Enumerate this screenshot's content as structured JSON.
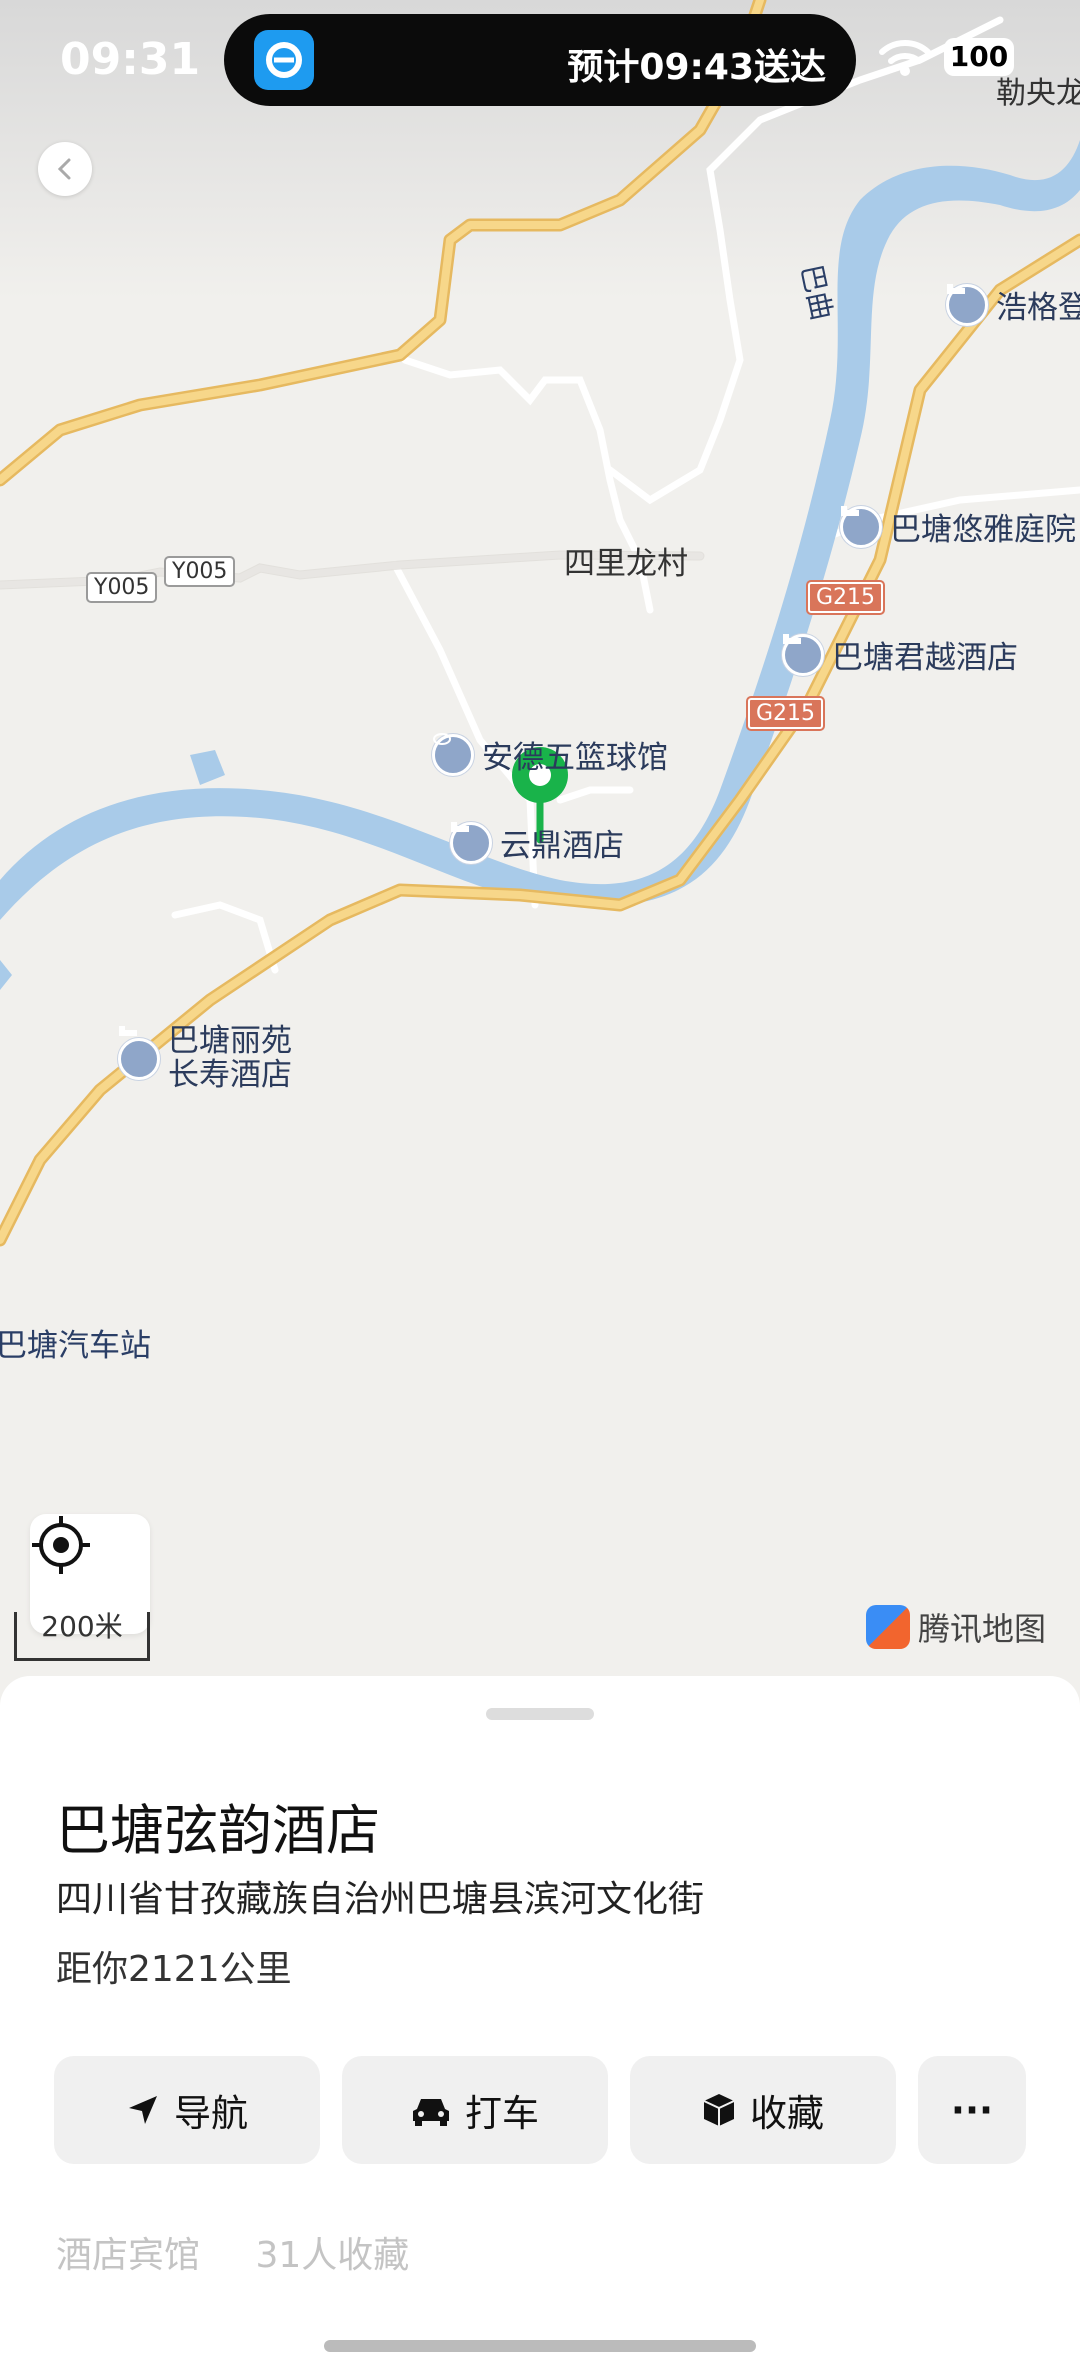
{
  "status_bar": {
    "time": "09:31",
    "eta": "预计09:43送达",
    "battery": "100"
  },
  "map": {
    "labels": {
      "village": "四里龙村",
      "river": "巴曲",
      "top_right": "勒央龙",
      "bus_station": "巴塘汽车站"
    },
    "poi": {
      "hotel_haoge": "浩格登",
      "hotel_youya": "巴塘悠雅庭院",
      "hotel_junyue": "巴塘君越酒店",
      "basketball": "安德五篮球馆",
      "hotel_yunding": "云鼎酒店",
      "hotel_liyuan_line1": "巴塘丽苑",
      "hotel_liyuan_line2": "长寿酒店"
    },
    "road_badges": {
      "y005_a": "Y005",
      "y005_b": "Y005",
      "g215_a": "G215",
      "g215_b": "G215"
    },
    "scale_label": "200米",
    "brand": "腾讯地图"
  },
  "sheet": {
    "title": "巴塘弦韵酒店",
    "address": "四川省甘孜藏族自治州巴塘县滨河文化街",
    "distance": "距你2121公里",
    "actions": {
      "navigate": "导航",
      "taxi": "打车",
      "favorite": "收藏",
      "more": "···"
    },
    "tags": [
      "酒店宾馆",
      "31人收藏"
    ]
  },
  "colors": {
    "river": "#a9cbe9",
    "road_major": "#f5cf78",
    "marker": "#19b34a"
  }
}
